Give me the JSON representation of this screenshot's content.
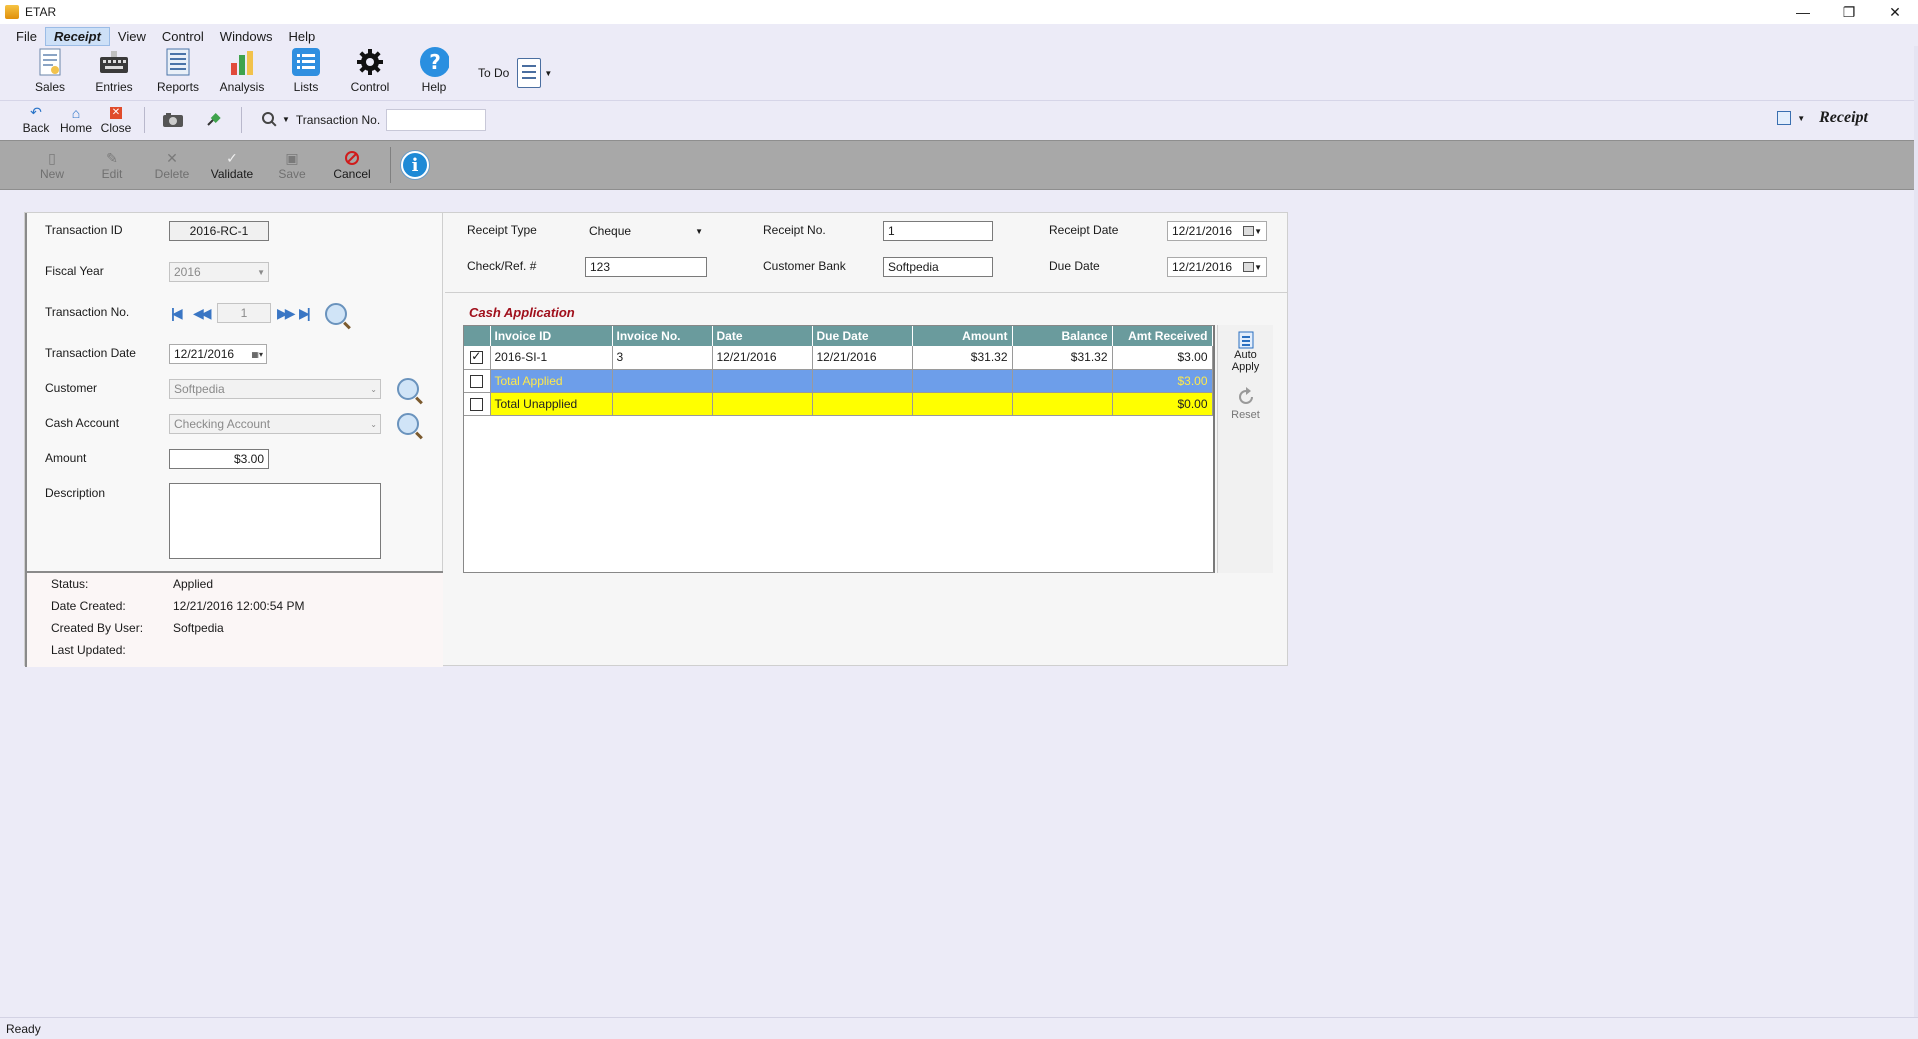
{
  "window": {
    "title": "ETAR",
    "min": "—",
    "max": "❐",
    "close": "✕"
  },
  "menu": [
    "File",
    "Receipt",
    "View",
    "Control",
    "Windows",
    "Help"
  ],
  "ribbon": {
    "sales": "Sales",
    "entries": "Entries",
    "reports": "Reports",
    "analysis": "Analysis",
    "lists": "Lists",
    "control": "Control",
    "help": "Help",
    "todo": "To Do"
  },
  "nav": {
    "back": "Back",
    "home": "Home",
    "close": "Close",
    "txn_label": "Transaction No.",
    "txn_value": "",
    "form_title": "Receipt"
  },
  "actions": {
    "new": "New",
    "edit": "Edit",
    "delete": "Delete",
    "validate": "Validate",
    "save": "Save",
    "cancel": "Cancel"
  },
  "form": {
    "transaction_id_label": "Transaction ID",
    "transaction_id": "2016-RC-1",
    "fiscal_year_label": "Fiscal Year",
    "fiscal_year": "2016",
    "transaction_no_label": "Transaction No.",
    "transaction_no": "1",
    "transaction_date_label": "Transaction Date",
    "transaction_date": "12/21/2016",
    "customer_label": "Customer",
    "customer": "Softpedia",
    "cash_account_label": "Cash Account",
    "cash_account": "Checking Account",
    "amount_label": "Amount",
    "amount": "$3.00",
    "description_label": "Description",
    "description": ""
  },
  "status": {
    "status_label": "Status:",
    "status": "Applied",
    "created_label": "Date Created:",
    "created": "12/21/2016 12:00:54 PM",
    "user_label": "Created By User:",
    "user": "Softpedia",
    "updated_label": "Last Updated:",
    "updated": ""
  },
  "receipt": {
    "type_label": "Receipt Type",
    "type": "Cheque",
    "no_label": "Receipt No.",
    "no": "1",
    "date_label": "Receipt Date",
    "date": "12/21/2016",
    "check_label": "Check/Ref. #",
    "check": "123",
    "bank_label": "Customer Bank",
    "bank": "Softpedia",
    "due_label": "Due Date",
    "due": "12/21/2016"
  },
  "cash": {
    "title": "Cash Application",
    "columns": [
      "Invoice ID",
      "Invoice No.",
      "Date",
      "Due Date",
      "Amount",
      "Balance",
      "Amt Received"
    ],
    "rows": [
      [
        "2016-SI-1",
        "3",
        "12/21/2016",
        "12/21/2016",
        "$31.32",
        "$31.32",
        "$3.00"
      ]
    ],
    "total_applied_label": "Total Applied",
    "total_applied": "$3.00",
    "total_unapplied_label": "Total Unapplied",
    "total_unapplied": "$0.00",
    "auto_apply": "Auto Apply",
    "reset": "Reset"
  },
  "statusbar": {
    "text": "Ready"
  },
  "colors": {
    "grid_header": "#6a9b9d",
    "applied_row": "#6d9eea",
    "unapplied_row": "#ffff00",
    "cash_title": "#a0101c"
  }
}
